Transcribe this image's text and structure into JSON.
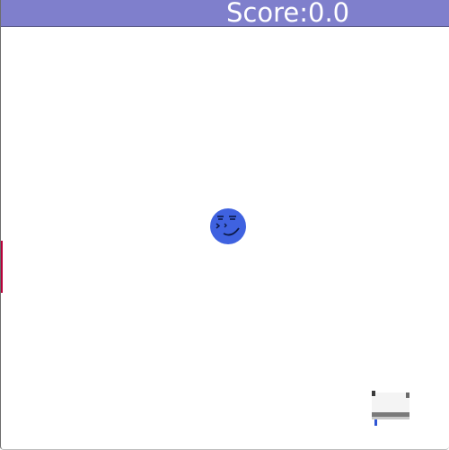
{
  "hud": {
    "score_text": "Score:0.0"
  },
  "player": {
    "icon": "smiling-face-icon",
    "color": "#3f62e0"
  },
  "sprite": {
    "icon": "ghost-sprite-icon"
  },
  "colors": {
    "score_bar": "#7f7fcc",
    "score_text": "#ffffff",
    "background": "#ffffff",
    "edge_accent": "#b8003a"
  }
}
